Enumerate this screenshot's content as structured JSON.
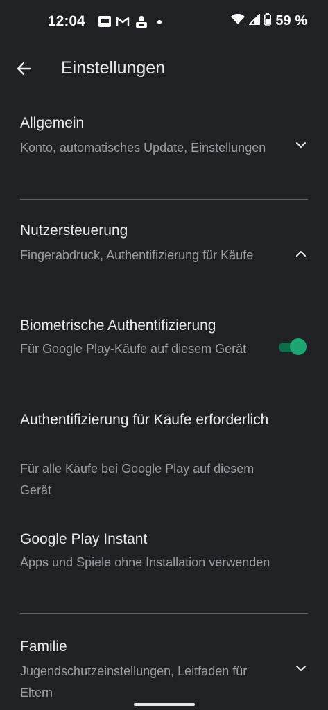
{
  "status_bar": {
    "time": "12:04",
    "battery_percent": "59 %",
    "notification_icons": [
      "mobile-app-icon",
      "gmail-icon",
      "game-icon"
    ]
  },
  "app_bar": {
    "title": "Einstellungen"
  },
  "sections": {
    "allgemein": {
      "title": "Allgemein",
      "subtitle": "Konto, automatisches Update, Einstellungen",
      "expanded": false
    },
    "nutzersteuerung": {
      "title": "Nutzersteuerung",
      "subtitle": "Fingerabdruck, Authentifizierung für Käufe",
      "expanded": true,
      "items": {
        "biometric": {
          "title": "Biometrische Authentifizierung",
          "subtitle": "Für Google Play-Käufe auf diesem Gerät",
          "toggle_on": true
        },
        "purchase_auth": {
          "title": "Authentifizierung für Käufe erforderlich",
          "subtitle": "Für alle Käufe bei Google Play auf diesem Gerät"
        },
        "instant": {
          "title": "Google Play Instant",
          "subtitle": "Apps und Spiele ohne Installation verwenden"
        }
      }
    },
    "familie": {
      "title": "Familie",
      "subtitle": "Jugendschutzeinstellungen, Leitfaden für Eltern",
      "expanded": false
    }
  },
  "colors": {
    "background": "#202124",
    "primary_text": "#e8eaed",
    "secondary_text": "#9aa0a6",
    "accent": "#1ea672"
  }
}
